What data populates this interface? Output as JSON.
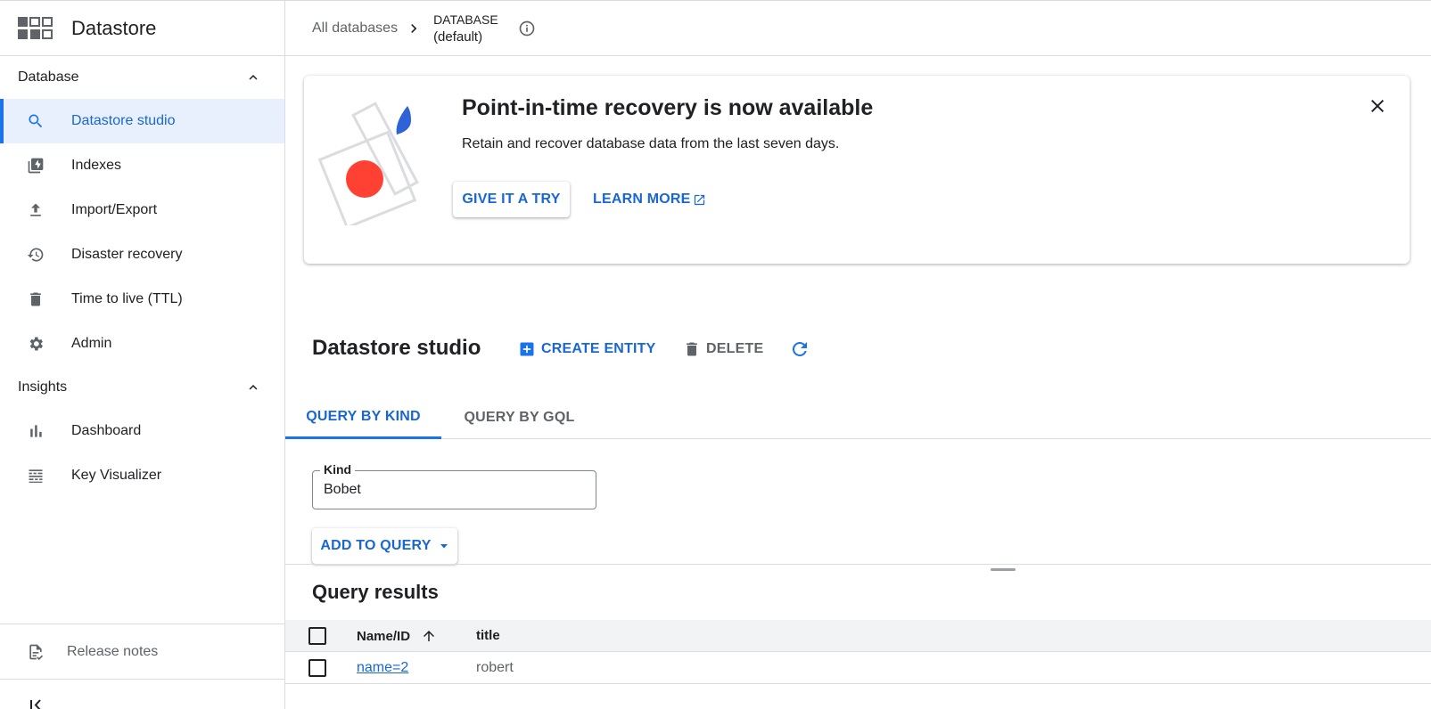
{
  "app": {
    "title": "Datastore"
  },
  "sidebar": {
    "sections": [
      {
        "label": "Database"
      },
      {
        "label": "Insights"
      }
    ],
    "items": [
      {
        "label": "Datastore studio",
        "icon": "search-icon"
      },
      {
        "label": "Indexes",
        "icon": "indexes-icon"
      },
      {
        "label": "Import/Export",
        "icon": "upload-icon"
      },
      {
        "label": "Disaster recovery",
        "icon": "history-icon"
      },
      {
        "label": "Time to live (TTL)",
        "icon": "trash-icon"
      },
      {
        "label": "Admin",
        "icon": "gear-icon"
      },
      {
        "label": "Dashboard",
        "icon": "bar-chart-icon"
      },
      {
        "label": "Key Visualizer",
        "icon": "heatmap-icon"
      }
    ],
    "release_notes": "Release notes"
  },
  "breadcrumb": {
    "root": "All databases",
    "db_label": "DATABASE",
    "db_value": "(default)"
  },
  "banner": {
    "title": "Point-in-time recovery is now available",
    "description": "Retain and recover database data from the last seven days.",
    "primary_button": "GIVE IT A TRY",
    "secondary_button": "LEARN MORE"
  },
  "studio": {
    "title": "Datastore studio",
    "create_label": "CREATE ENTITY",
    "delete_label": "DELETE"
  },
  "tabs": [
    {
      "label": "QUERY BY KIND",
      "active": true
    },
    {
      "label": "QUERY BY GQL",
      "active": false
    }
  ],
  "kind_field": {
    "label": "Kind",
    "value": "Bobet"
  },
  "add_to_query": "ADD TO QUERY",
  "results": {
    "title": "Query results",
    "columns": [
      "Name/ID",
      "title"
    ],
    "rows": [
      {
        "name": "name=2",
        "title": "robert"
      }
    ]
  },
  "colors": {
    "accent": "#1a73e8",
    "accent_text": "#1967d2",
    "active_bg": "#e8f0fe",
    "illustration_red": "#ff4133",
    "illustration_blue": "#2f62d6"
  }
}
